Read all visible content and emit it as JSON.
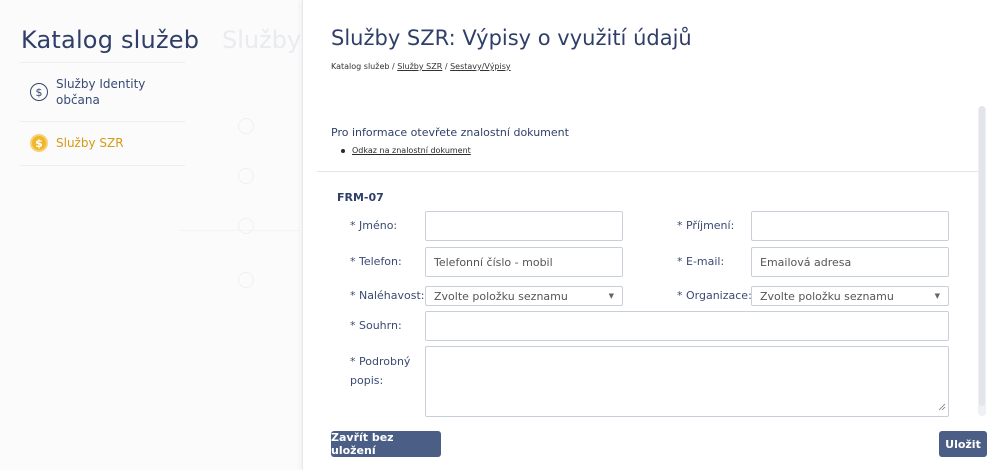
{
  "sidebar": {
    "title": "Katalog služeb",
    "items": [
      {
        "label": "Služby Identity občana",
        "icon": "dollar-circle-icon"
      },
      {
        "label": "Služby SZR",
        "icon": "dollar-circle-icon"
      }
    ]
  },
  "modal": {
    "title": "Služby SZR: Výpisy o využití údajů",
    "breadcrumb": {
      "root": "Katalog služeb",
      "sep1": " / ",
      "level2": "Služby SZR",
      "sep2": " / ",
      "level3": "Sestavy/Výpisy"
    },
    "info_text": "Pro informace otevřete znalostní dokument",
    "info_link": "Odkaz na znalostní dokument",
    "form_code": "FRM-07",
    "fields": {
      "first_name": {
        "label": "* Jméno:",
        "value": ""
      },
      "last_name": {
        "label": "* Příjmení:",
        "value": ""
      },
      "phone": {
        "label": "* Telefon:",
        "placeholder": "Telefonní číslo - mobil"
      },
      "email": {
        "label": "* E-mail:",
        "placeholder": "Emailová adresa"
      },
      "urgency": {
        "label": "* Naléhavost:",
        "value": "Zvolte položku seznamu"
      },
      "organization": {
        "label": "* Organizace:",
        "value": "Zvolte položku seznamu"
      },
      "summary": {
        "label": "* Souhrn:",
        "value": ""
      },
      "description": {
        "label": "* Podrobný popis:",
        "value": ""
      }
    },
    "buttons": {
      "close": "Zavřít bez uložení",
      "save": "Uložit"
    }
  },
  "colors": {
    "accent": "#4a5e86",
    "active": "#f0b72a",
    "text": "#2f3f69"
  }
}
